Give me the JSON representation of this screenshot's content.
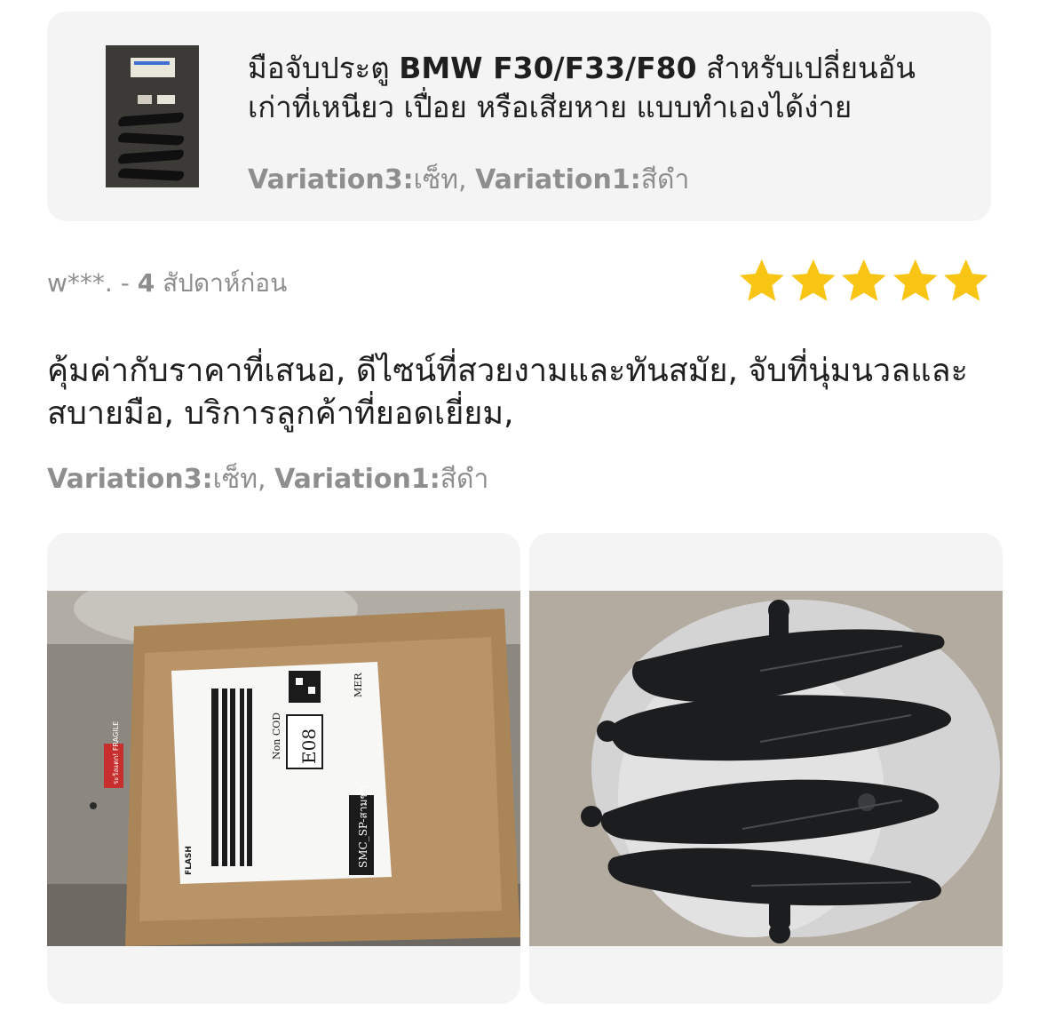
{
  "product": {
    "title_part1": "มือจับประตู ",
    "title_model": "BMW F30/F33/F80",
    "title_part2": " สำหรับเปลี่ยนอันเก่าที่เหนียว เปื่อย หรือเสียหาย แบบทำเองได้ง่าย",
    "thumbnail_icon": "door-handle-product-photo",
    "variation": {
      "v3_label": "Variation3:",
      "v3_value": "เซ็ท",
      "separator": ", ",
      "v1_label": "Variation1:",
      "v1_value": "สีดำ"
    }
  },
  "review": {
    "reviewer": "w***.",
    "time_separator": " - ",
    "time_number": "4",
    "time_unit": " สัปดาห์ก่อน",
    "rating": 5,
    "rating_max": 5,
    "star_color": "#f9c514",
    "text": "คุ้มค่ากับราคาที่เสนอ, ดีไซน์ที่สวยงามและทันสมัย, จับที่นุ่มนวลและสบายมือ, บริการลูกค้าที่ยอดเยี่ยม,",
    "variation": {
      "v3_label": "Variation3:",
      "v3_value": "เซ็ท",
      "separator": ", ",
      "v1_label": "Variation1:",
      "v1_value": "สีดำ"
    },
    "photos": [
      {
        "icon": "package-box-photo",
        "label_texts": [
          "E08",
          "Non COD",
          "SMC_SP-สามชุก",
          "MER",
          "ระวังแตก! FRAGILE",
          "FLASH"
        ]
      },
      {
        "icon": "door-handles-photo"
      }
    ]
  }
}
